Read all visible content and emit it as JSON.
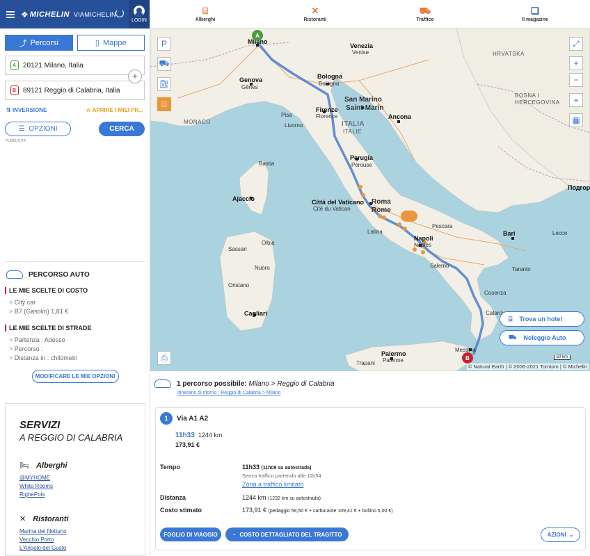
{
  "header": {
    "brand": "MICHELIN",
    "sub_brand": "VIAMICHELIN",
    "login": "LOGIN"
  },
  "nav": {
    "items": [
      {
        "label": "Alberghi",
        "icon": "bed-icon"
      },
      {
        "label": "Ristoranti",
        "icon": "cutlery-icon"
      },
      {
        "label": "Traffico",
        "icon": "car-icon"
      },
      {
        "label": "Il magazine",
        "icon": "book-icon"
      }
    ]
  },
  "left": {
    "tab_routes": "Percorsi",
    "tab_maps": "Mappe",
    "from": "20121 Milano, Italia",
    "to": "89121 Reggio di Calabria, Italia",
    "swap": "INVERSIONE",
    "favorites": "APRIRE I MIEI PR...",
    "options": "OPZIONI",
    "search": "CERCA",
    "ad_label": "PUBBLICITÀ",
    "route_title": "PERCORSO AUTO",
    "cost_title": "LE MIE SCELTE DI COSTO",
    "cost_items": [
      "City car",
      "B7 (Gasolio) 1,81 €"
    ],
    "road_title": "LE MIE SCELTE DI STRADE",
    "road_items": [
      "Partenza : Adesso",
      "Percorso :",
      "Distanza in : chilometri"
    ],
    "modify": "MODIFICARE LE MIE OPZIONI",
    "services_title": "SERVIZI",
    "services_sub": "A REGGIO DI CALABRIA",
    "hotels_head": "Alberghi",
    "hotels": [
      "@MYHOME",
      "White Rooms",
      "RighePois"
    ],
    "restaurants_head": "Ristoranti",
    "restaurants": [
      "Marina del Nettuno",
      "Vecchio Porto",
      "L'Angolo del Gusto"
    ]
  },
  "map": {
    "labels": {
      "milano": "Milano",
      "bologna1": "Bologna",
      "bologna2": "Bologna",
      "genova1": "Genova",
      "genova2": "Gênes",
      "sanmarino1": "San Marino",
      "sanmarino2": "Saint-Marin",
      "firenze1": "Firenze",
      "firenze2": "Florence",
      "italia1": "ITALIA",
      "italia2": "ITALIE",
      "perugia1": "Perugia",
      "perugia2": "Pérouse",
      "roma1": "Roma",
      "roma2": "Rome",
      "vaticano1": "Città del Vaticano",
      "vaticano2": "Cité du Vatican",
      "napoli1": "Napoli",
      "napoli2": "Naples",
      "bari": "Bari",
      "ajaccio": "Ajaccio",
      "bastia": "Bastia",
      "cagliari": "Cagliari",
      "palermo1": "Palermo",
      "palermo2": "Palerme",
      "messina": "Messina",
      "venezia1": "Venezia",
      "venezia2": "Venise",
      "ancona": "Ancona",
      "monaco": "MONACO",
      "hrvatska": "HRVATSKA",
      "bosna1": "BOSNA I",
      "bosna2": "HERCEGOVINA",
      "podgor": "Подгор",
      "salerno": "Salerno",
      "trapani": "Trapani",
      "nuoro": "Nuoro",
      "sassari": "Sassari",
      "livorno": "Livorno",
      "pisa": "Pisa",
      "pescara": "Pescara",
      "latina": "Latina",
      "taranto": "Taranto",
      "cosenza": "Cosenza",
      "catanzaro": "Catanzaro",
      "lecce": "Lecce",
      "olbia": "Olbia",
      "oristano": "Oristano"
    },
    "hotel_btn": "Trova un hotel",
    "rental_btn": "Noleggio Auto",
    "scale": "50 km",
    "attribution": "© Natural Earth | © 2006-2021 Tomtom | © Michelin",
    "marker_a": "A",
    "marker_b": "B"
  },
  "results": {
    "count_label": "1 percorso possibile:",
    "route_label": "Milano > Reggio di Calabria",
    "return_link": "Itinerario di ritorno : Reggio di Calabria > Milano",
    "route_num": "1",
    "via": "Via A1 A2",
    "time_short": "11h33",
    "dist_short": "1244 km",
    "cost_short": "173,91 €",
    "time_label": "Tempo",
    "time_value": "11h33",
    "time_detail": "(11h09 su autostrada)",
    "no_traffic": "Senza traffico partendo alle 11h54",
    "zona": "Zona a traffico limitato",
    "distance_label": "Distanza",
    "distance_value": "1244 km",
    "distance_detail": "(1232 km su autostrada)",
    "cost_label": "Costo stimato",
    "cost_value": "173,91 €",
    "cost_detail": "(pedaggio 59,50 € + carburante 109,41 € + bollino 5,00 €)",
    "roadbook_btn": "FOGLIO DI VIAGGIO",
    "cost_detail_btn": "COSTO DETTAGLIATO DEL TRAGITTO",
    "actions_btn": "AZIONI"
  },
  "colors": {
    "primary": "#27509b",
    "accent": "#3a78d6",
    "route": "#4a7ed0",
    "orange": "#e9963e",
    "sea": "#aad3df",
    "land": "#f2efe6"
  }
}
